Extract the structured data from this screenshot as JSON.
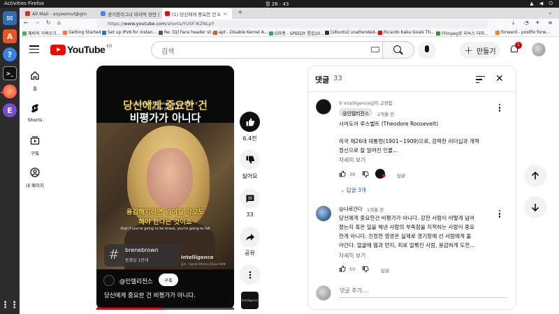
{
  "system": {
    "activities": "Activities",
    "app_name": "Firefox",
    "clock": "월 26 : 43"
  },
  "browser": {
    "tabs": [
      {
        "label": "All Mail - soyeomul@gm",
        "favicon_color": "#d93025"
      },
      {
        "label": "경기창이그녀 마지막 장면 |",
        "favicon_color": "#4285f4"
      },
      {
        "label": "(1) 당신에게 중요한 건 b",
        "favicon_color": "#ff0000",
        "active": true
      }
    ],
    "url_prefix": "https://",
    "url_host": "www.youtube.com",
    "url_path": "/shorts/YUSF.IKZNLpY",
    "bookmarks": [
      {
        "label": "체비의 거북오기...",
        "color": "#4caf50"
      },
      {
        "label": "Getting Started",
        "color": "#ff7139"
      },
      {
        "label": "Set up IPv6 for instan...",
        "color": "#1a73e8"
      },
      {
        "label": "Re: [Q] Face header st...",
        "color": "#555555"
      },
      {
        "label": "apt - Disable Kernel A...",
        "color": "#e95420"
      },
      {
        "label": "G마켓 - SPEEDY 통합20...",
        "color": "#2bb24c"
      },
      {
        "label": "[Ubuntu] unattended-...",
        "color": "#333333"
      },
      {
        "label": "Ricardo Kaka Goals Th...",
        "color": "#ff0000"
      },
      {
        "label": "FFmpeg로 리눅스 터미...",
        "color": "#3a8f3a"
      },
      {
        "label": "forward - postfix forw...",
        "color": "#f48024"
      }
    ]
  },
  "youtube": {
    "logo_text": "YouTube",
    "region": "KR",
    "search_placeholder": "검색",
    "create_label": "만들기",
    "notification_count": "1",
    "nav": [
      {
        "label": "홈",
        "icon": "home-icon"
      },
      {
        "label": "Shorts",
        "icon": "shorts-icon"
      },
      {
        "label": "구독",
        "icon": "subscriptions-icon"
      },
      {
        "label": "내 페이지",
        "icon": "you-icon"
      }
    ]
  },
  "video": {
    "title_line1": "당신에게 중요한 건",
    "title_line2": "비평가가 아니다",
    "subtitle_en_top": "criticism that's when I learned that if",
    "subtitle_en_top2": "you're going to",
    "caption_ko_line1": "용감해지려면 넘어질 각오도",
    "caption_ko_line2": "해야 한다는 것이죠",
    "subtitle_en_bottom": "that if you're going to be brave, you're going to fall",
    "hashtag": "brenebrown",
    "hashtag_count": "동영상 1만개",
    "watermark": "Intelligence",
    "watermark_sub": "출처 : Oprah Winfrey Show OWN",
    "channel_name": "@인텔리전스",
    "subscribe_label": "구독",
    "caption": "당신에게 중요한 건 비평가가 아니다.",
    "progress": 0.48
  },
  "actions": {
    "like_count": "6.4천",
    "dislike_label": "싫어요",
    "comment_count": "33",
    "share_label": "공유",
    "sound_thumb_label": "Intelligence"
  },
  "comments": {
    "title": "댓글",
    "count": "33",
    "add_placeholder": "댓글 추가...",
    "items": [
      {
        "pinned_label": "Intelligence님이 고정함",
        "author": "@인텔리전스",
        "time": "2개월 전",
        "lines": [
          "시어도어 루스벨트 (Theodore Roosevelt)",
          "",
          "미국 제26대 대통령(1901~1909)으로, 강력한 리더십과 개혁",
          "정신으로 잘 알려진 인물..."
        ],
        "more_label": "자세히 보기",
        "likes": "39",
        "reply_label": "답글",
        "replies_label": "답글 3개"
      },
      {
        "author": "@나로간다",
        "time": "1개월 전",
        "lines": [
          "당신에게 중요한건 비평가가 아니다. 강한 사람이 어떻게 넘어",
          "졌는지 혹은 일을 해낸 사람의 부족함을 지적하는 사람이 중요",
          "한게 아니다. 진정한 영광은 실제로 경기장에 선 사람에게 돌",
          "아간다. 얼굴에 땀과 먼지, 피로 얼룩진 사람, 용감하게 도전..."
        ],
        "more_label": "자세히 보기",
        "likes": "50",
        "reply_label": "답글"
      }
    ]
  },
  "colors": {
    "brand_red": "#ff0000",
    "link_blue": "#065fd4",
    "caption_yellow": "#f5d23b",
    "ubuntu_orange": "#e95420"
  }
}
